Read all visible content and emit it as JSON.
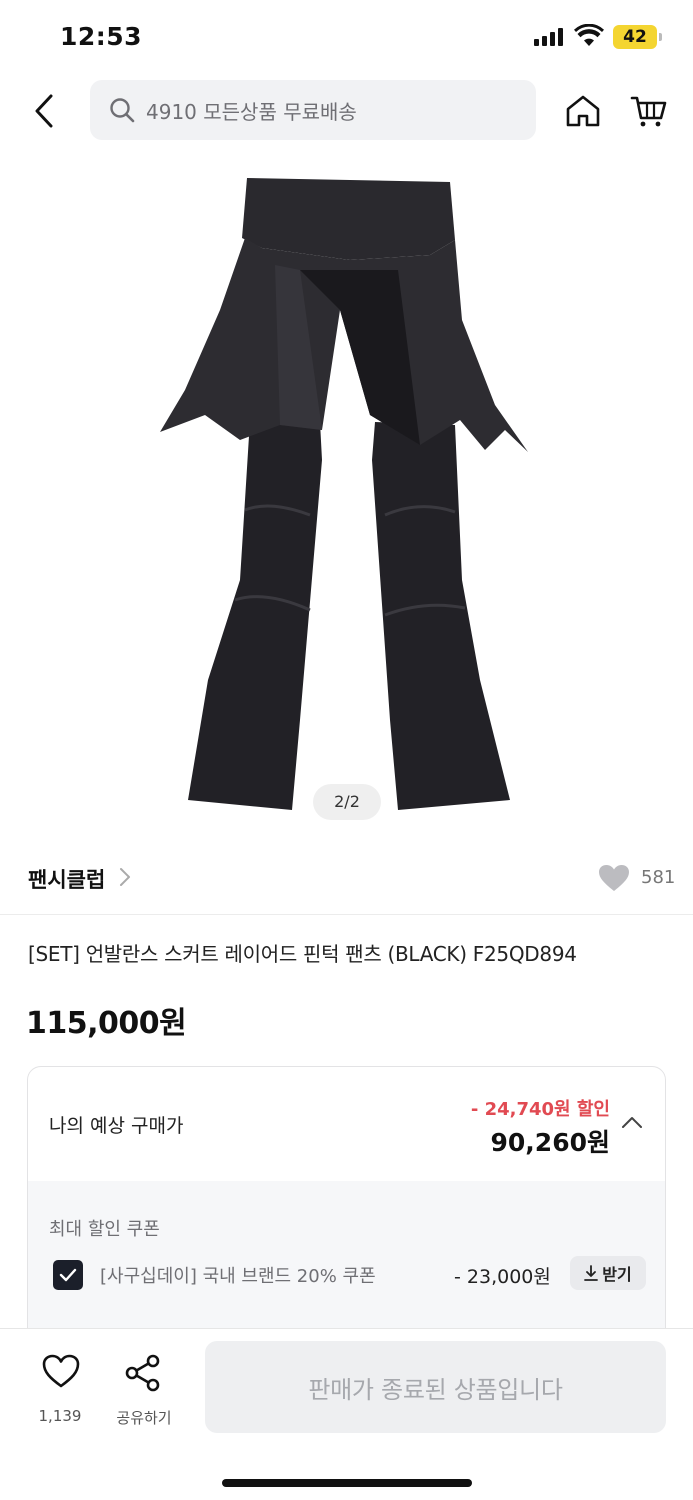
{
  "status_bar": {
    "time": "12:53",
    "battery": "42",
    "icons": [
      "signal-icon",
      "wifi-icon",
      "battery-icon"
    ]
  },
  "header": {
    "search_text": "4910 모든상품 무료배송",
    "icons": [
      "back-icon",
      "search-icon",
      "home-icon",
      "cart-icon"
    ]
  },
  "gallery": {
    "page_indicator": "2/2"
  },
  "brand": {
    "name": "팬시클럽",
    "like_count": "581"
  },
  "product": {
    "title": "[SET] 언발란스 스커트 레이어드 핀턱 팬츠 (BLACK) F25QD894",
    "price": "115,000원"
  },
  "estimate": {
    "label": "나의 예상 구매가",
    "discount": "- 24,740원 할인",
    "final_price": "90,260원",
    "coupon_section_title": "최대 할인 쿠폰",
    "coupon": {
      "name": "[사구십데이] 국내 브랜드 20% 쿠폰",
      "amount": "- 23,000원",
      "get_label": "받기",
      "checked": true
    }
  },
  "bottom_bar": {
    "like_count": "1,139",
    "share_label": "공유하기",
    "sold_out_label": "판매가 종료된 상품입니다"
  },
  "colors": {
    "discount_red": "#e14a52",
    "battery_yellow": "#f4d531",
    "checkbox_dark": "#1b1f2a"
  }
}
